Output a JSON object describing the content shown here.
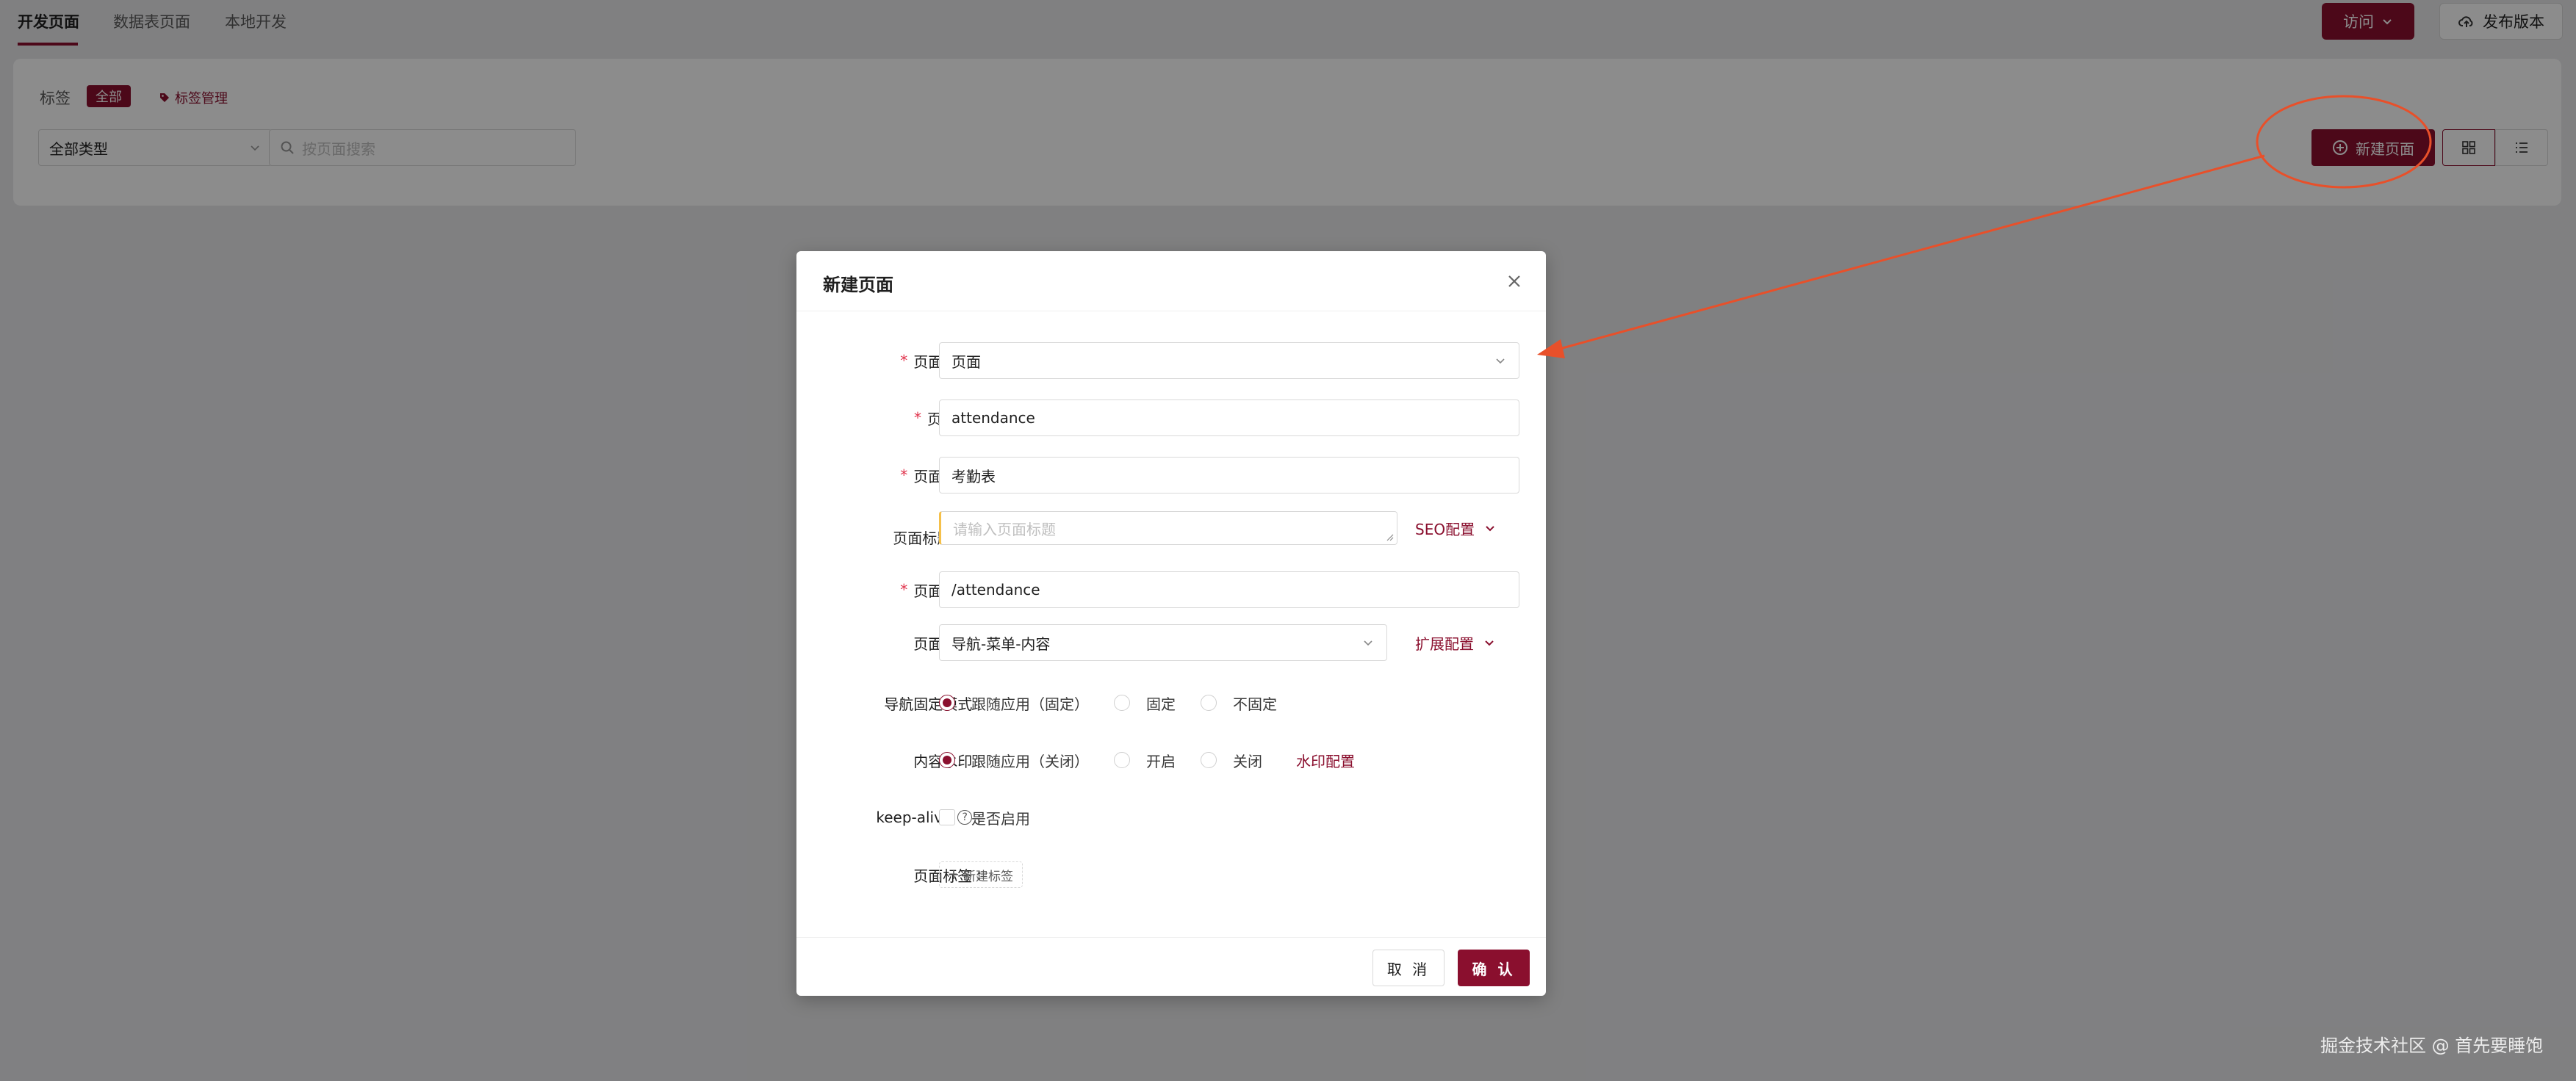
{
  "topbar": {
    "tabs": [
      "开发页面",
      "数据表页面",
      "本地开发"
    ],
    "visit_label": "访问",
    "publish_label": "发布版本"
  },
  "filter": {
    "tags_label": "标签",
    "tag_all": "全部",
    "tag_manage": "标签管理",
    "type_select": "全部类型",
    "search_placeholder": "按页面搜索",
    "new_page_label": "新建页面"
  },
  "modal": {
    "title": "新建页面",
    "fields": {
      "page_type": {
        "label": "页面类型",
        "value": "页面"
      },
      "page_id": {
        "label": "页面ID",
        "value": "attendance"
      },
      "page_name": {
        "label": "页面名称",
        "value": "考勤表"
      },
      "page_title": {
        "label": "页面标题",
        "placeholder": "请输入页面标题",
        "side_link": "SEO配置"
      },
      "page_path": {
        "label": "页面路径",
        "value": "/attendance"
      },
      "page_layout": {
        "label": "页面布局",
        "value": "导航-菜单-内容",
        "side_link": "扩展配置"
      },
      "nav_fixed": {
        "label": "导航固定模式",
        "options": [
          "跟随应用（固定）",
          "固定",
          "不固定"
        ]
      },
      "watermark": {
        "label": "内容水印",
        "options": [
          "跟随应用（关闭）",
          "开启",
          "关闭"
        ],
        "side_link": "水印配置"
      },
      "keep_alive": {
        "label": "keep-alive",
        "checkbox_label": "是否启用"
      },
      "page_tags": {
        "label": "页面标签",
        "add_label": "新建标签"
      }
    },
    "cancel_label": "取 消",
    "ok_label": "确 认"
  },
  "watermark_text": "掘金技术社区 @ 首先要睡饱",
  "colors": {
    "accent": "#8a0f2e",
    "annotation": "#e8502a",
    "required": "#e0324b"
  }
}
